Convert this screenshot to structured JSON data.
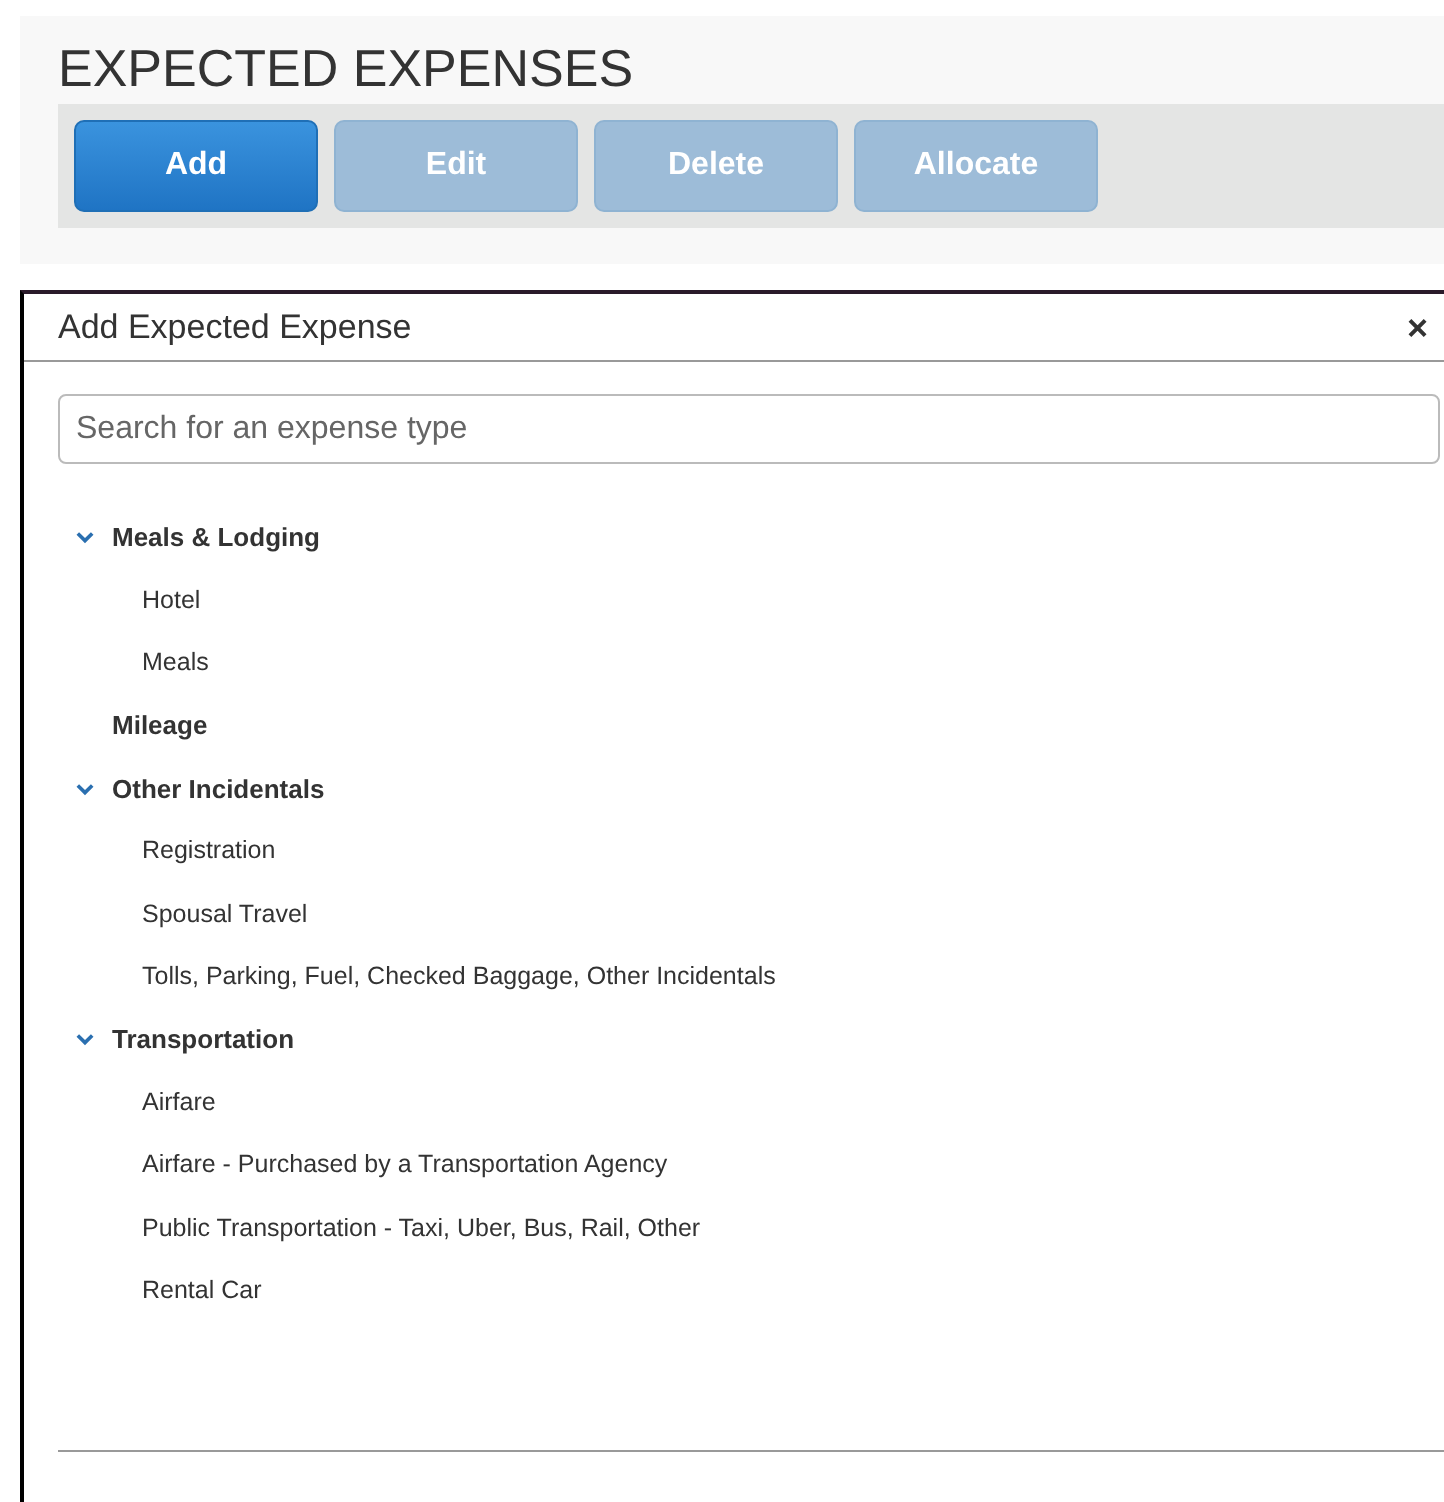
{
  "panel": {
    "title": "EXPECTED EXPENSES",
    "buttons": [
      {
        "label": "Add",
        "disabled": false
      },
      {
        "label": "Edit",
        "disabled": true
      },
      {
        "label": "Delete",
        "disabled": true
      },
      {
        "label": "Allocate",
        "disabled": true
      }
    ]
  },
  "dialog": {
    "title": "Add Expected Expense",
    "close": "×",
    "search": {
      "placeholder": "Search for an expense type"
    },
    "tree": [
      {
        "label": "Meals & Lodging",
        "expanded": true,
        "children": [
          {
            "label": "Hotel"
          },
          {
            "label": "Meals"
          }
        ]
      },
      {
        "label": "Mileage"
      },
      {
        "label": "Other Incidentals",
        "expanded": true,
        "children": [
          {
            "label": "Registration"
          },
          {
            "label": "Spousal Travel"
          },
          {
            "label": "Tolls, Parking, Fuel, Checked Baggage, Other Incidentals"
          }
        ]
      },
      {
        "label": "Transportation",
        "expanded": true,
        "children": [
          {
            "label": "Airfare"
          },
          {
            "label": "Airfare - Purchased by a Transportation Agency"
          },
          {
            "label": "Public Transportation - Taxi, Uber, Bus, Rail, Other"
          },
          {
            "label": "Rental Car"
          }
        ]
      }
    ]
  }
}
